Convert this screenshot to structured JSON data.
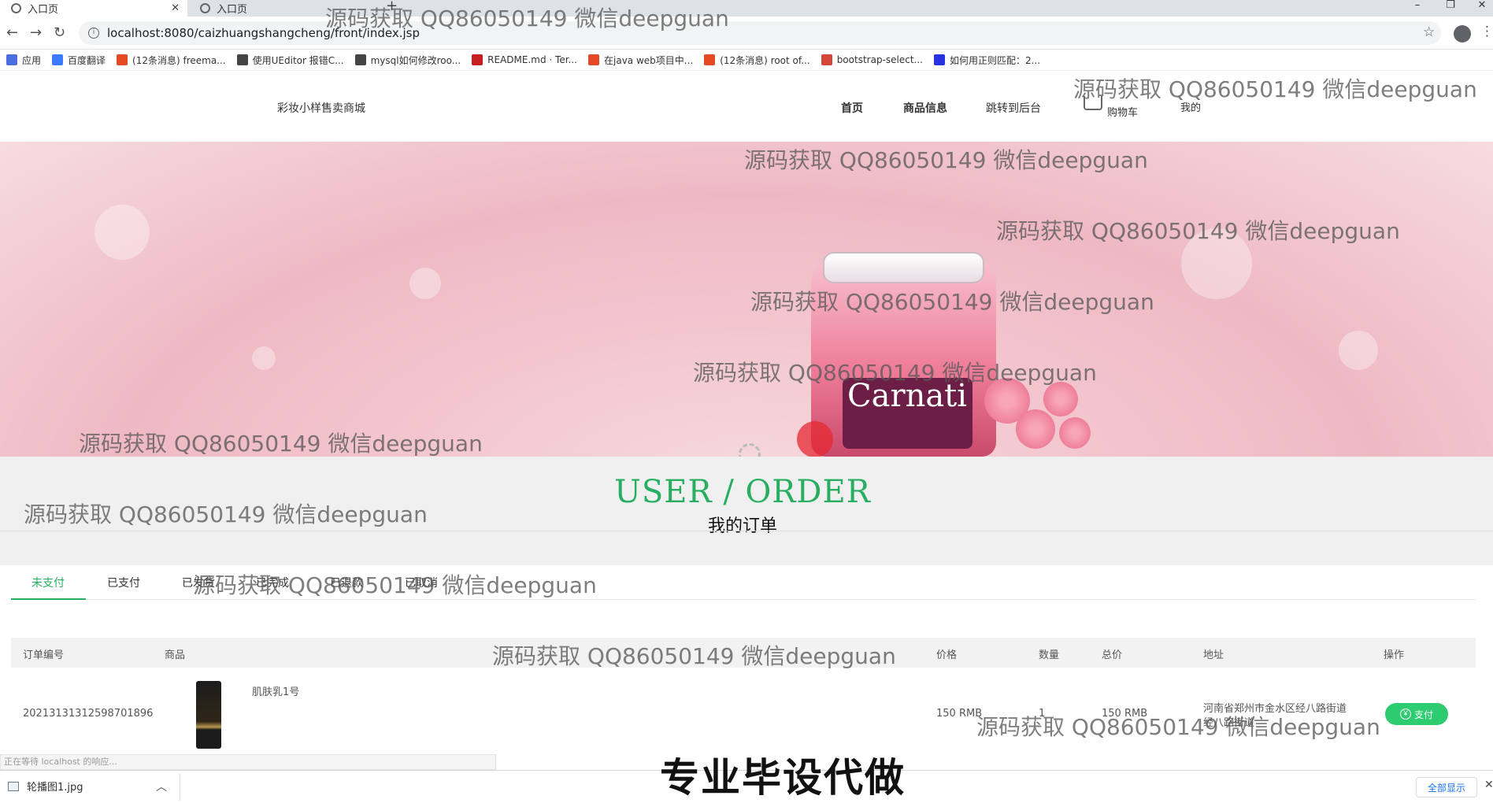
{
  "browser": {
    "tabs": [
      {
        "label": "入口页",
        "active": true
      },
      {
        "label": "入口页",
        "active": false
      }
    ],
    "new_tab_symbol": "+",
    "url": "localhost:8080/caizhuangshangcheng/front/index.jsp",
    "window_controls": {
      "minimize": "–",
      "maximize": "❐",
      "close": "✕"
    },
    "bookmarks": [
      {
        "label": "应用",
        "icon": "apps-grid-icon",
        "color": "#4a6ee0"
      },
      {
        "label": "百度翻译",
        "icon": "baidu-fanyi-icon",
        "color": "#3b7bff"
      },
      {
        "label": "(12条消息) freema...",
        "icon": "csdn-icon",
        "color": "#e34a25"
      },
      {
        "label": "使用UEditor 报错C...",
        "icon": "site-icon",
        "color": "#444"
      },
      {
        "label": "mysql如何修改roo...",
        "icon": "site-icon",
        "color": "#444"
      },
      {
        "label": "README.md · Ter...",
        "icon": "gitee-icon",
        "color": "#c71d23"
      },
      {
        "label": "在java web项目中...",
        "icon": "csdn-icon",
        "color": "#e34a25"
      },
      {
        "label": "(12条消息) root of...",
        "icon": "csdn-icon",
        "color": "#e34a25"
      },
      {
        "label": "bootstrap-select...",
        "icon": "site-icon",
        "color": "#d4463a"
      },
      {
        "label": "如何用正则匹配：2...",
        "icon": "baidu-icon",
        "color": "#2932e1"
      }
    ]
  },
  "site": {
    "brand": "彩妆小样售卖商城",
    "nav": [
      {
        "label": "首页"
      },
      {
        "label": "商品信息"
      },
      {
        "label": "跳转到后台"
      },
      {
        "label": "购物车"
      },
      {
        "label": "我的"
      }
    ]
  },
  "section": {
    "title_en": "USER / ORDER",
    "title_cn": "我的订单",
    "accent_color": "#27ae60"
  },
  "order_tabs": [
    "未支付",
    "已支付",
    "已发货",
    "已完成",
    "已退款",
    "已取消"
  ],
  "table": {
    "headers": [
      "订单编号",
      "商品",
      "价格",
      "数量",
      "总价",
      "地址",
      "操作"
    ],
    "rows": [
      {
        "order_no": "20213131312598701896",
        "product_name": "肌肤乳1号",
        "price": "150 RMB",
        "qty": "1",
        "total": "150 RMB",
        "address_line1": "河南省郑州市金水区经八路街道",
        "address_line2": "经八路街道",
        "action": "支付"
      }
    ]
  },
  "status_text": "正在等待 localhost 的响应...",
  "download": {
    "file": "轮播图1.jpg",
    "show_all": "全部显示"
  },
  "watermarks": [
    "源码获取 QQ86050149 微信deepguan",
    "源码获取 QQ86050149 微信deepguan",
    "源码获取 QQ86050149 微信deepguan",
    "源码获取 QQ86050149 微信deepguan",
    "源码获取 QQ86050149 微信deepguan",
    "源码获取 QQ86050149 微信deepguan",
    "源码获取 QQ86050149 微信deepguan",
    "源码获取 QQ86050149 微信deepguan",
    "源码获取 QQ86050149 微信deepguan",
    "源码获取 QQ86050149 微信deepguan"
  ],
  "promo_text": "专业毕设代做"
}
